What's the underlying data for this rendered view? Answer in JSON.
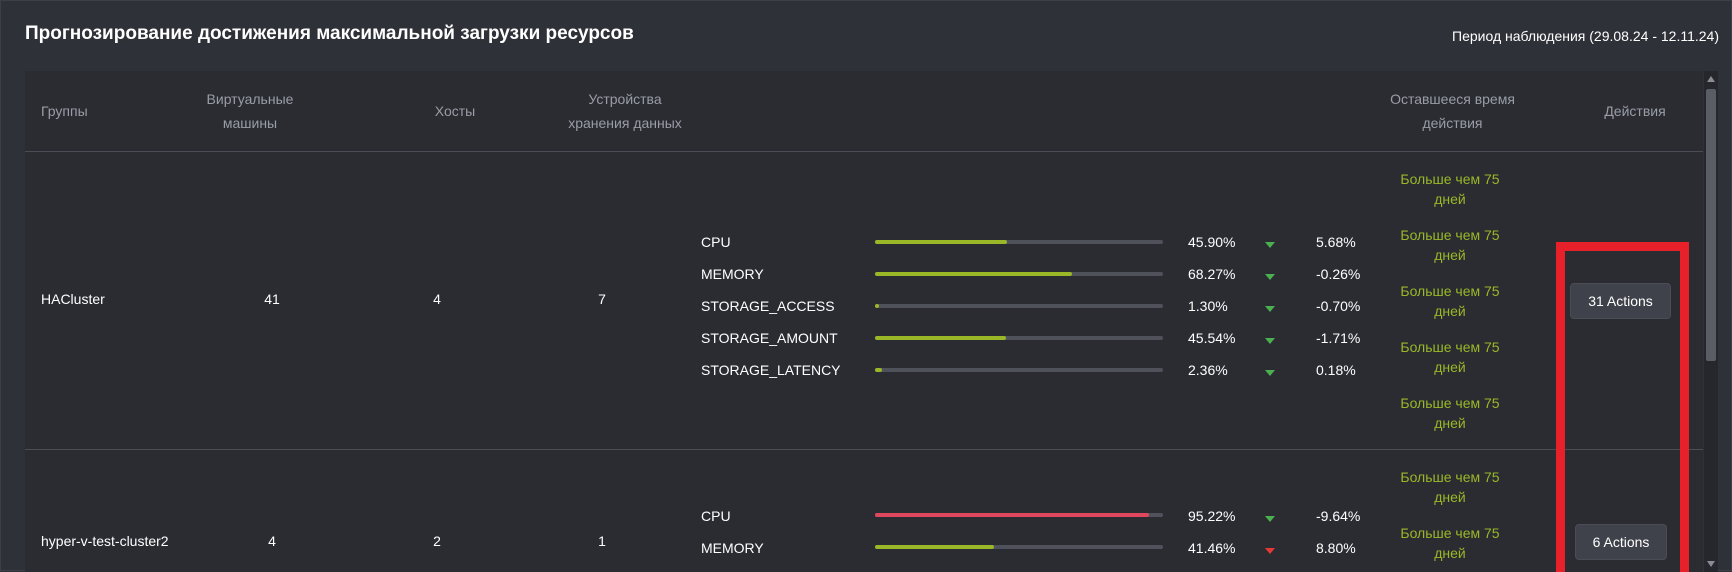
{
  "header": {
    "title": "Прогнозирование достижения максимальной загрузки ресурсов",
    "period": "Период наблюдения (29.08.24 - 12.11.24)"
  },
  "columns": {
    "groups": "Группы",
    "vms_line1": "Виртуальные",
    "vms_line2": "машины",
    "hosts": "Хосты",
    "storage_line1": "Устройства",
    "storage_line2": "хранения данных",
    "remaining_line1": "Оставшееся время",
    "remaining_line2": "действия",
    "actions": "Действия"
  },
  "rows": [
    {
      "group": "HACluster",
      "vms": "41",
      "hosts": "4",
      "storage": "7",
      "action_label": "31 Actions",
      "metrics": [
        {
          "name": "CPU",
          "percent": "45.90%",
          "fill": 45.9,
          "trend": "down",
          "delta": "5.68%",
          "remaining_line1": "Больше чем 75",
          "remaining_line2": "дней",
          "bar_color": "#9ab728"
        },
        {
          "name": "MEMORY",
          "percent": "68.27%",
          "fill": 68.27,
          "trend": "down",
          "delta": "-0.26%",
          "remaining_line1": "Больше чем 75",
          "remaining_line2": "дней",
          "bar_color": "#9ab728"
        },
        {
          "name": "STORAGE_ACCESS",
          "percent": "1.30%",
          "fill": 1.3,
          "trend": "down",
          "delta": "-0.70%",
          "remaining_line1": "Больше чем 75",
          "remaining_line2": "дней",
          "bar_color": "#9ab728"
        },
        {
          "name": "STORAGE_AMOUNT",
          "percent": "45.54%",
          "fill": 45.54,
          "trend": "down",
          "delta": "-1.71%",
          "remaining_line1": "Больше чем 75",
          "remaining_line2": "дней",
          "bar_color": "#9ab728"
        },
        {
          "name": "STORAGE_LATENCY",
          "percent": "2.36%",
          "fill": 2.36,
          "trend": "down",
          "delta": "0.18%",
          "remaining_line1": "Больше чем 75",
          "remaining_line2": "дней",
          "bar_color": "#9ab728"
        }
      ]
    },
    {
      "group": "hyper-v-test-cluster2",
      "vms": "4",
      "hosts": "2",
      "storage": "1",
      "action_label": "6 Actions",
      "metrics": [
        {
          "name": "CPU",
          "percent": "95.22%",
          "fill": 95.22,
          "trend": "down",
          "delta": "-9.64%",
          "remaining_line1": "Больше чем 75",
          "remaining_line2": "дней",
          "bar_color": "#e0475f"
        },
        {
          "name": "MEMORY",
          "percent": "41.46%",
          "fill": 41.46,
          "trend": "up",
          "delta": "8.80%",
          "remaining_line1": "Больше чем 75",
          "remaining_line2": "дней",
          "bar_color": "#9ab728"
        }
      ]
    }
  ],
  "colors": {
    "ok": "#9ab728",
    "critical": "#e0475f",
    "trend_down": "#4caf50",
    "trend_up": "#e53935",
    "highlight": "#e8202a"
  }
}
